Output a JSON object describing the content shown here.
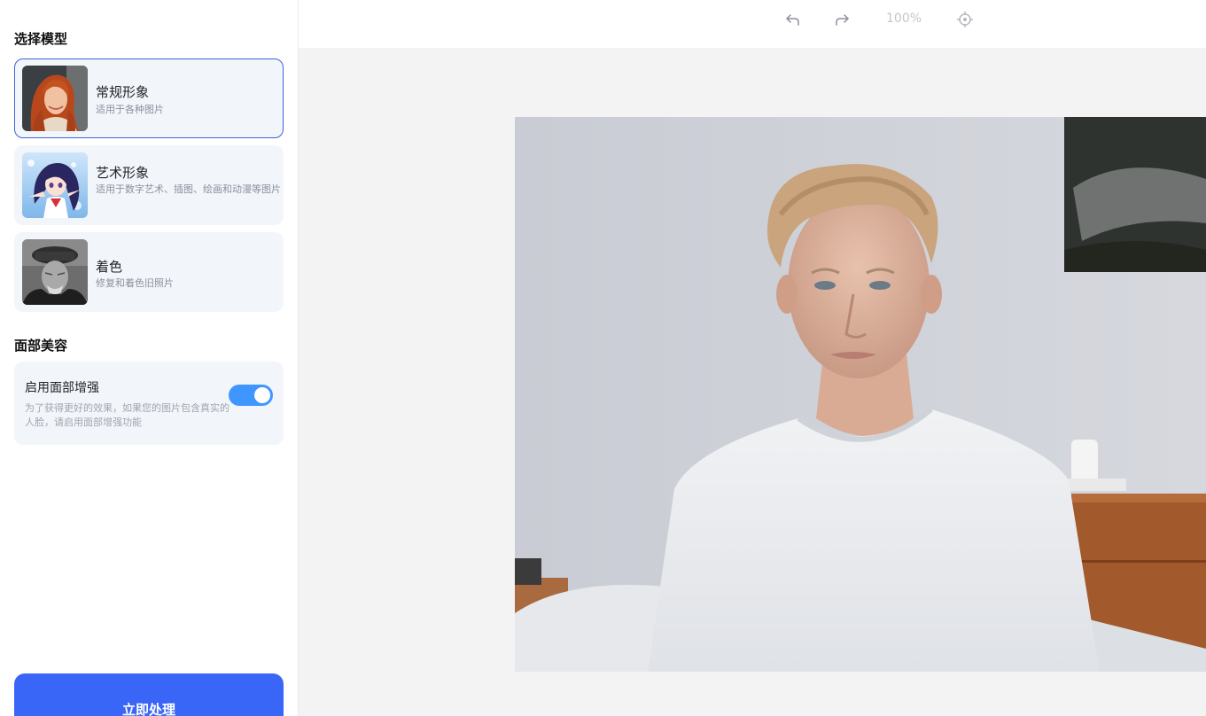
{
  "sidebar": {
    "model_section_title": "选择模型",
    "models": [
      {
        "title": "常规形象",
        "desc": "适用于各种图片",
        "thumbnail": "red-haired-woman-portrait"
      },
      {
        "title": "艺术形象",
        "desc": "适用于数字艺术、插图、绘画和动漫等图片",
        "thumbnail": "anime-girl-illustration"
      },
      {
        "title": "着色",
        "desc": "修复和着色旧照片",
        "thumbnail": "old-man-bw-photo"
      }
    ],
    "selected_model": "常规形象",
    "face_section_title": "面部美容",
    "face_enhance": {
      "title": "启用面部增强",
      "desc": "为了获得更好的效果，如果您的图片包含真实的人脸，请启用面部增强功能",
      "enabled": true
    },
    "process_label": "立即处理"
  },
  "toolbar": {
    "undo_icon": "undo-icon",
    "redo_icon": "redo-icon",
    "zoom": "100%",
    "fit_icon": "crosshair-icon"
  },
  "canvas": {
    "image": "young-man-white-tshirt-bedroom-photo"
  },
  "colors": {
    "accent": "#3a66f7",
    "toggle_on": "#4096ff",
    "selected_border": "#3d63d6",
    "card_bg": "#f2f5fa",
    "canvas_bg": "#f3f3f3"
  }
}
